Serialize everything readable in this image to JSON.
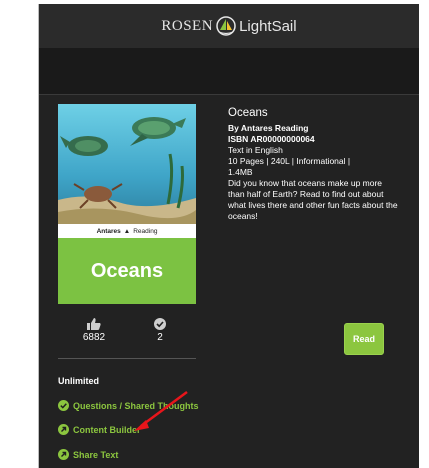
{
  "header": {
    "brand_left": "ROSEN",
    "brand_right": "LightSail"
  },
  "book": {
    "cover_publisher_bold": "Antares",
    "cover_publisher": "Reading",
    "cover_title": "Oceans",
    "title": "Oceans",
    "author": "By Antares Reading",
    "isbn": "ISBN AR00000000064",
    "language": "Text in English",
    "details": "10 Pages | 240L | Informational |",
    "size": "1.4MB",
    "description": "Did you know that oceans make up more than half of Earth? Read to find out about what lives there and other fun facts about the oceans!"
  },
  "stats": {
    "likes": "6882",
    "checks": "2"
  },
  "actions": {
    "read_label": "Read",
    "section_label": "Unlimited",
    "questions_label": "Questions / Shared Thoughts",
    "content_builder_label": "Content Builder",
    "share_label": "Share Text"
  },
  "colors": {
    "accent": "#8cc63f",
    "arrow": "#e8151b",
    "background": "#222222"
  }
}
